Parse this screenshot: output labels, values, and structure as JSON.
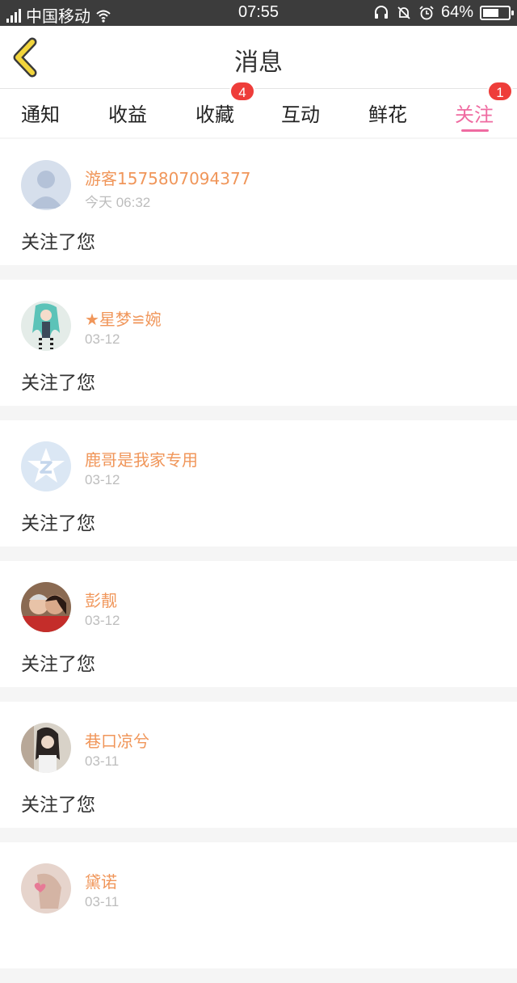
{
  "status_bar": {
    "carrier": "中国移动",
    "network": "4G",
    "time": "07:55",
    "battery_text": "64%",
    "battery_level": 0.64,
    "icons": [
      "signal-icon",
      "wifi-icon",
      "headset-icon",
      "mute-bell-icon",
      "alarm-icon",
      "battery-icon"
    ]
  },
  "header": {
    "title": "消息",
    "back_icon": "chevron-left-icon",
    "accent": "#f2d53c"
  },
  "tabs": [
    {
      "label": "通知",
      "badge": null,
      "active": false
    },
    {
      "label": "收益",
      "badge": null,
      "active": false
    },
    {
      "label": "收藏",
      "badge": "4",
      "active": false
    },
    {
      "label": "互动",
      "badge": null,
      "active": false
    },
    {
      "label": "鲜花",
      "badge": null,
      "active": false
    },
    {
      "label": "关注",
      "badge": "1",
      "active": true
    }
  ],
  "colors": {
    "active_tab": "#ef6ba1",
    "badge": "#ee3d3a",
    "username": "#f0965a"
  },
  "messages": [
    {
      "name": "游客1575807094377",
      "time": "今天 06:32",
      "text": "关注了您",
      "avatar": "default-user-avatar"
    },
    {
      "name": "★星梦≌婉",
      "time": "03-12",
      "text": "关注了您",
      "avatar": "anime-avatar"
    },
    {
      "name": "鹿哥是我家专用",
      "time": "03-12",
      "text": "关注了您",
      "avatar": "qzone-star-avatar"
    },
    {
      "name": "彭靓",
      "time": "03-12",
      "text": "关注了您",
      "avatar": "couple-photo-avatar"
    },
    {
      "name": "巷口凉兮",
      "time": "03-11",
      "text": "关注了您",
      "avatar": "girl-photo-avatar"
    },
    {
      "name": "黛诺",
      "time": "03-11",
      "text": "",
      "avatar": "heart-hand-avatar"
    }
  ]
}
